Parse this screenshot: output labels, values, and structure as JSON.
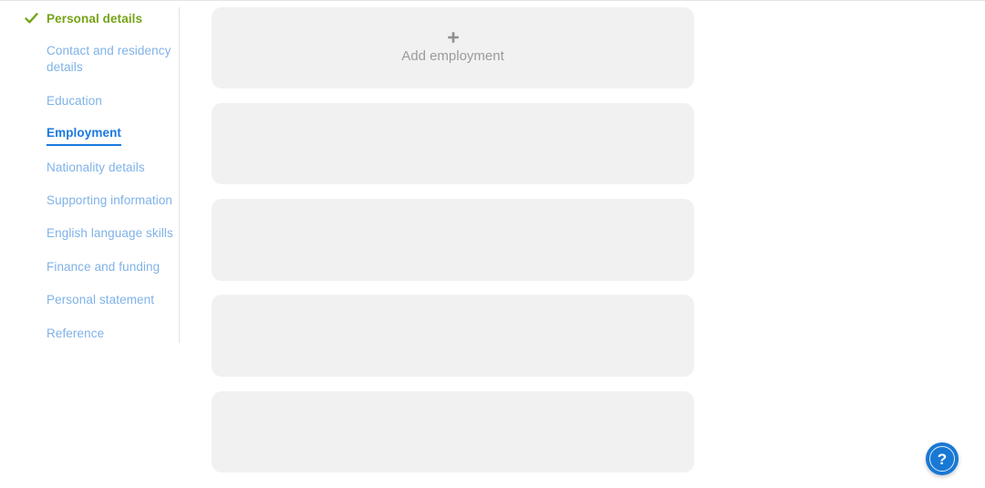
{
  "sidebar": {
    "items": [
      {
        "label": "Personal details",
        "state": "complete",
        "icon": "check-icon"
      },
      {
        "label": "Contact and residency details",
        "state": "default"
      },
      {
        "label": "Education",
        "state": "default"
      },
      {
        "label": "Employment",
        "state": "current"
      },
      {
        "label": "Nationality details",
        "state": "default"
      },
      {
        "label": "Supporting information",
        "state": "default"
      },
      {
        "label": "English language skills",
        "state": "default"
      },
      {
        "label": "Finance and funding",
        "state": "default"
      },
      {
        "label": "Personal statement",
        "state": "default"
      },
      {
        "label": "Reference",
        "state": "default"
      }
    ],
    "colors": {
      "complete": "#76a317",
      "current": "#1a7ae0",
      "default": "#7fb2e8",
      "divider": "#e2e2e2"
    }
  },
  "main": {
    "add_card": {
      "icon": "plus-icon",
      "label": "Add employment"
    },
    "placeholder_cards": [
      {
        "label": ""
      },
      {
        "label": ""
      },
      {
        "label": ""
      },
      {
        "label": ""
      }
    ],
    "colors": {
      "card_background": "#f1f1f1",
      "card_text": "#9b9b9b"
    }
  },
  "help": {
    "icon": "question-mark-icon",
    "glyph": "?",
    "color": "#1878d4"
  }
}
